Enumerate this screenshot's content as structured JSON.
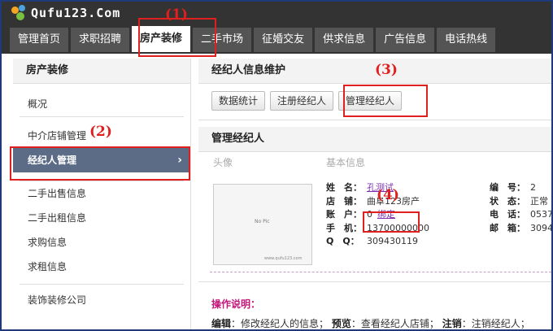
{
  "brand": {
    "logo_text": "Qufu123.Com"
  },
  "nav": {
    "tabs": [
      "管理首页",
      "求职招聘",
      "房产装修",
      "二手市场",
      "征婚交友",
      "供求信息",
      "广告信息",
      "电话热线"
    ],
    "active_index": 2
  },
  "sidebar": {
    "title": "房产装修",
    "items": [
      "概况",
      "中介店铺管理",
      "经纪人管理",
      "二手出售信息",
      "二手出租信息",
      "求购信息",
      "求租信息",
      "装饰装修公司"
    ],
    "active_label": "经纪人管理",
    "chevron": "›"
  },
  "panel": {
    "title": "经纪人信息维护",
    "buttons": [
      "数据统计",
      "注册经纪人",
      "管理经纪人"
    ]
  },
  "manage": {
    "title": "管理经纪人",
    "col_photo": "头像",
    "col_info": "基本信息",
    "photo_text": "No Pic",
    "photo_footer": "www.qufu123.com",
    "fields": {
      "name_label": "姓　名：",
      "name_value": "孔测试",
      "shop_label": "店　铺：",
      "shop_value": "曲阜123房产",
      "account_label": "账　户：",
      "account_value": "0",
      "bind_label": "绑定",
      "phone_label": "手　机：",
      "phone_value": "13700000000",
      "qq_label": "Q　Q：",
      "qq_value": "309430119",
      "id_label": "编　号：",
      "id_value": "2",
      "status_label": "状　态：",
      "status_value": "正常",
      "tel_label": "电　话：",
      "tel_value": "0537",
      "mail_label": "邮　箱：",
      "mail_value": "3094"
    }
  },
  "notice": {
    "title": "操作说明：",
    "edit_label": "编辑",
    "edit_text": "：修改经纪人的信息；",
    "preview_label": "预览",
    "preview_text": "：查看经纪人店铺；",
    "cancel_label": "注销",
    "cancel_text": "：注销经纪人；"
  },
  "annotations": [
    "(1)",
    "(2)",
    "(3)",
    "(4)"
  ],
  "colors": {
    "highlight": "#e0201f",
    "nav_bg": "#333333",
    "active_side": "#5c6b86",
    "notice_title": "#c4177a"
  }
}
